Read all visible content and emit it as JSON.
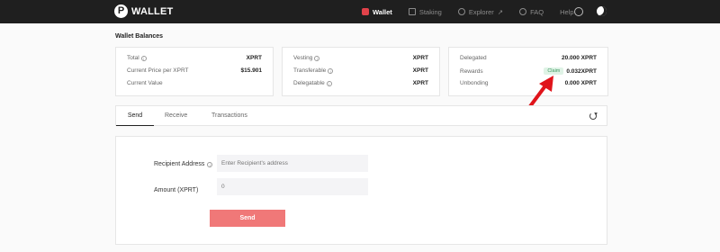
{
  "brand": {
    "logo_letter": "P",
    "name": "WALLET"
  },
  "nav": {
    "items": [
      {
        "label": "Wallet",
        "icon": "wallet-icon",
        "active": true
      },
      {
        "label": "Staking",
        "icon": "staking-icon",
        "active": false
      },
      {
        "label": "Explorer",
        "icon": "explorer-icon",
        "active": false
      },
      {
        "label": "FAQ",
        "icon": "help-circle-icon",
        "active": false
      },
      {
        "label": "Help",
        "icon": "",
        "active": false
      }
    ],
    "explorer_suffix": "↗"
  },
  "balances": {
    "title": "Wallet Balances",
    "card1": [
      {
        "label": "Total",
        "value": "XPRT",
        "info": true
      },
      {
        "label": "Current Price per XPRT",
        "value": "$15.901",
        "info": false
      },
      {
        "label": "Current Value",
        "value": "",
        "info": false
      }
    ],
    "card2": [
      {
        "label": "Vesting",
        "value": "XPRT",
        "info": true
      },
      {
        "label": "Transferable",
        "value": "XPRT",
        "info": true
      },
      {
        "label": "Delegatable",
        "value": "XPRT",
        "info": true
      }
    ],
    "card3": [
      {
        "label": "Delegated",
        "value": "20.000 XPRT"
      },
      {
        "label": "Rewards",
        "value": "0.032XPRT",
        "badge": "Claim"
      },
      {
        "label": "Unbonding",
        "value": "0.000 XPRT"
      }
    ]
  },
  "tabs": [
    {
      "label": "Send",
      "active": true
    },
    {
      "label": "Receive",
      "active": false
    },
    {
      "label": "Transactions",
      "active": false
    }
  ],
  "form": {
    "recipient_label": "Recipient Address",
    "recipient_placeholder": "Enter Recipient's address",
    "amount_label": "Amount (XPRT)",
    "amount_placeholder": "0",
    "send_label": "Send"
  },
  "colors": {
    "nav_bg": "#1f1f1f",
    "accent": "#e1424a",
    "send_button": "#f07878",
    "claim_badge_bg": "#dff3e6",
    "annotation_arrow": "#e0141b"
  }
}
